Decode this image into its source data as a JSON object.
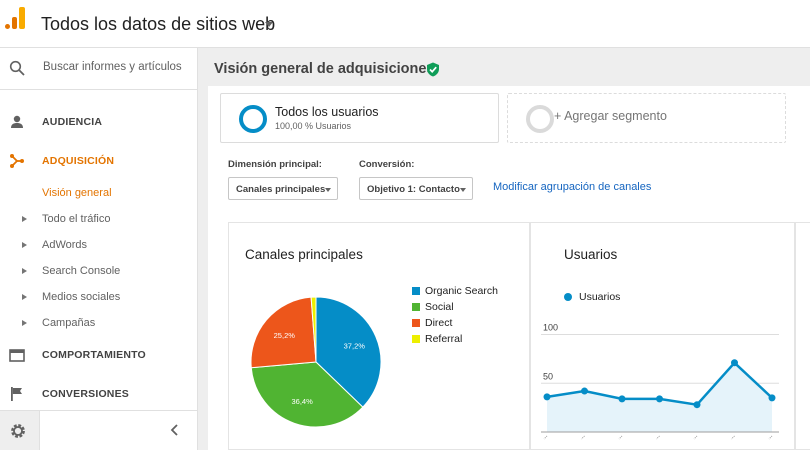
{
  "header": {
    "title": "Todos los datos de sitios web"
  },
  "sidebar": {
    "search_placeholder": "Buscar informes y artículos",
    "sections": [
      {
        "label": "AUDIENCIA",
        "icon": "person-icon"
      },
      {
        "label": "ADQUISICIÓN",
        "icon": "acquisition-icon",
        "active": true
      },
      {
        "label": "COMPORTAMIENTO",
        "icon": "behavior-icon"
      },
      {
        "label": "CONVERSIONES",
        "icon": "flag-icon"
      }
    ],
    "acquisition_items": [
      {
        "label": "Visión general",
        "active": true
      },
      {
        "label": "Todo el tráfico"
      },
      {
        "label": "AdWords"
      },
      {
        "label": "Search Console"
      },
      {
        "label": "Medios sociales"
      },
      {
        "label": "Campañas"
      }
    ]
  },
  "main": {
    "page_title": "Visión general de adquisiciones",
    "segments": [
      {
        "name": "Todos los usuarios",
        "sub": "100,00 % Usuarios"
      },
      {
        "name": "+ Agregar segmento"
      }
    ],
    "dimension_label": "Dimensión principal:",
    "dimension_value": "Canales principales",
    "conversion_label": "Conversión:",
    "conversion_value": "Objetivo 1: Contacto",
    "modify_link": "Modificar agrupación de canales"
  },
  "colors": {
    "accent": "#e37400",
    "organic": "#058dc7",
    "social": "#50b432",
    "direct": "#ed561b",
    "referral": "#edef00",
    "link": "#1565c0"
  },
  "chart_data": [
    {
      "type": "pie",
      "title": "Canales principales",
      "categories": [
        "Organic Search",
        "Social",
        "Direct",
        "Referral"
      ],
      "values": [
        37.2,
        36.4,
        25.2,
        1.2
      ],
      "labels": [
        "37,2%",
        "36,4%",
        "25,2%",
        ""
      ],
      "colors": [
        "#058dc7",
        "#50b432",
        "#ed561b",
        "#edef00"
      ]
    },
    {
      "type": "area",
      "title": "Usuarios",
      "series": [
        {
          "name": "Usuarios",
          "values": [
            36,
            42,
            34,
            34,
            28,
            71,
            35
          ]
        }
      ],
      "yticks": [
        50,
        100
      ],
      "ylim": [
        0,
        120
      ]
    }
  ]
}
